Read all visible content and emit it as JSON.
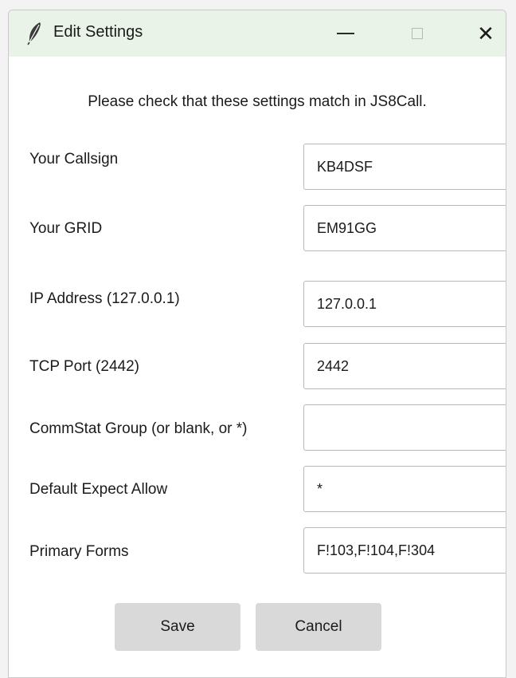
{
  "window": {
    "title": "Edit Settings",
    "app_icon": "feather-icon",
    "controls": {
      "minimize_icon": "minimize-icon",
      "maximize_icon": "maximize-icon",
      "close_icon": "close-icon",
      "close_glyph": "✕"
    }
  },
  "dialog": {
    "instruction": "Please check that these settings match in JS8Call.",
    "fields": [
      {
        "label": "Your Callsign",
        "value": "KB4DSF"
      },
      {
        "label": "Your GRID",
        "value": "EM91GG"
      },
      {
        "label": "IP Address (127.0.0.1)",
        "value": "127.0.0.1"
      },
      {
        "label": "TCP Port (2442)",
        "value": "2442"
      },
      {
        "label": "CommStat Group (or blank, or *)",
        "value": ""
      },
      {
        "label": "Default Expect Allow",
        "value": "*"
      },
      {
        "label": "Primary Forms",
        "value": "F!103,F!104,F!304"
      }
    ]
  },
  "buttons": {
    "save_label": "Save",
    "cancel_label": "Cancel"
  },
  "colors": {
    "titlebar_bg": "#eaf3e7",
    "button_bg": "#d9d9d9",
    "field_border": "#b9b9b9"
  }
}
